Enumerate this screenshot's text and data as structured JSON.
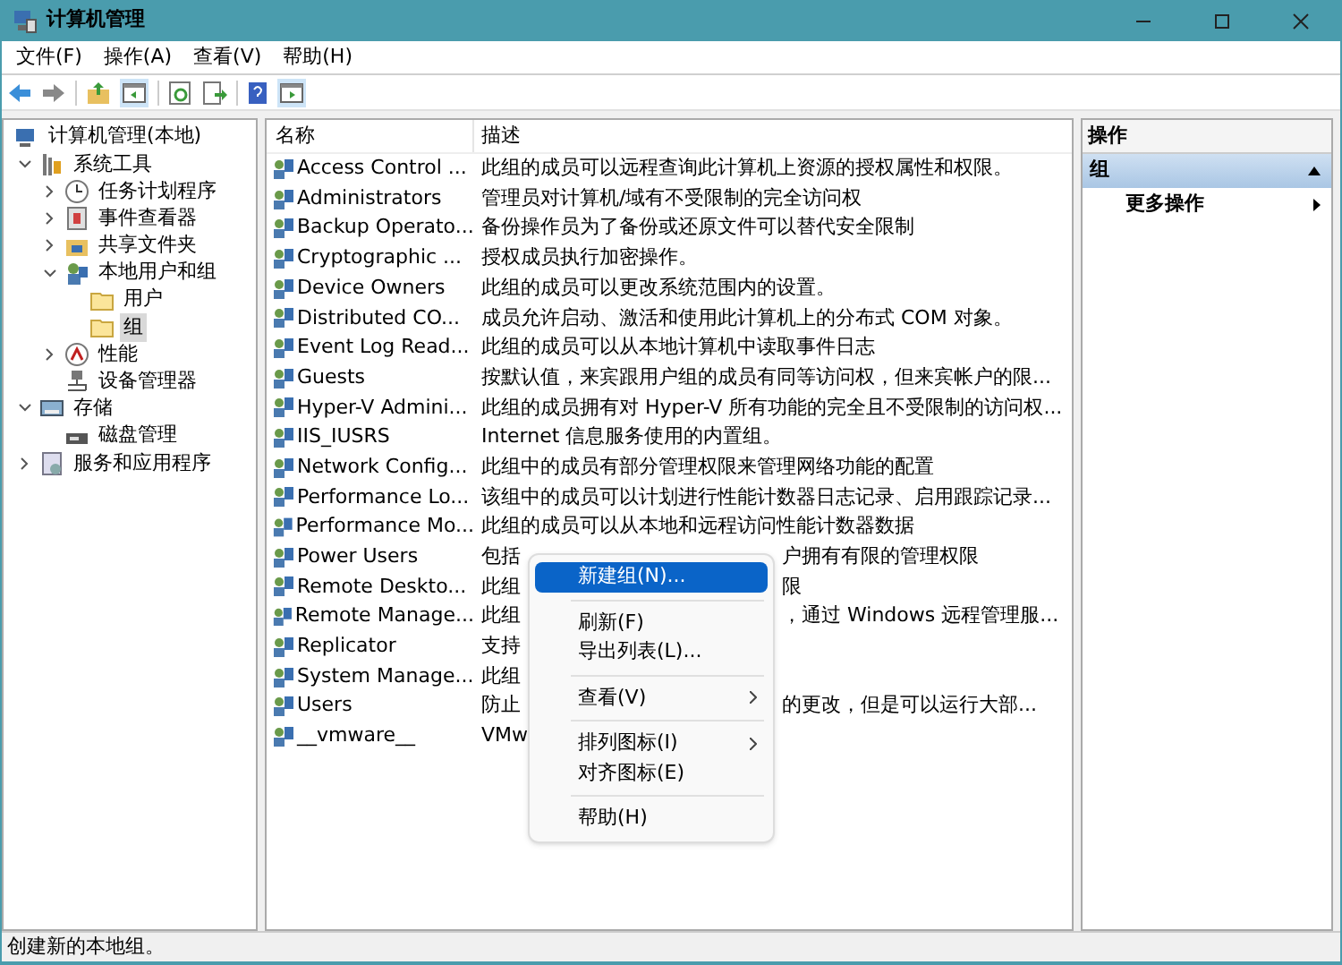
{
  "window": {
    "title": "计算机管理"
  },
  "menu_bar": [
    "文件(F)",
    "操作(A)",
    "查看(V)",
    "帮助(H)"
  ],
  "tree": [
    {
      "label": "计算机管理(本地)",
      "kind": "computer",
      "selected": false,
      "children": [
        {
          "label": "系统工具",
          "kind": "tools",
          "selected": false,
          "expanded": true,
          "children": [
            {
              "label": "任务计划程序",
              "kind": "clock",
              "selected": false,
              "expanded": false
            },
            {
              "label": "事件查看器",
              "kind": "log",
              "selected": false,
              "expanded": false
            },
            {
              "label": "共享文件夹",
              "kind": "share",
              "selected": false,
              "expanded": false
            },
            {
              "label": "本地用户和组",
              "kind": "users",
              "selected": false,
              "expanded": true,
              "children": [
                {
                  "label": "用户",
                  "kind": "folder",
                  "selected": false
                },
                {
                  "label": "组",
                  "kind": "folder",
                  "selected": true
                }
              ]
            },
            {
              "label": "性能",
              "kind": "perf",
              "selected": false,
              "expanded": false
            },
            {
              "label": "设备管理器",
              "kind": "device",
              "selected": false
            }
          ]
        },
        {
          "label": "存储",
          "kind": "storage",
          "selected": false,
          "expanded": true,
          "children": [
            {
              "label": "磁盘管理",
              "kind": "disk",
              "selected": false
            }
          ]
        },
        {
          "label": "服务和应用程序",
          "kind": "services",
          "selected": false,
          "expanded": false
        }
      ]
    }
  ],
  "table": {
    "columns": [
      "名称",
      "描述"
    ],
    "rows": [
      {
        "name": "Access Control ...",
        "description": "此组的成员可以远程查询此计算机上资源的授权属性和权限。"
      },
      {
        "name": "Administrators",
        "description": "管理员对计算机/域有不受限制的完全访问权"
      },
      {
        "name": "Backup Operato...",
        "description": "备份操作员为了备份或还原文件可以替代安全限制"
      },
      {
        "name": "Cryptographic ...",
        "description": "授权成员执行加密操作。"
      },
      {
        "name": "Device Owners",
        "description": "此组的成员可以更改系统范围内的设置。"
      },
      {
        "name": "Distributed CO...",
        "description": "成员允许启动、激活和使用此计算机上的分布式 COM 对象。"
      },
      {
        "name": "Event Log Read...",
        "description": "此组的成员可以从本地计算机中读取事件日志"
      },
      {
        "name": "Guests",
        "description": "按默认值，来宾跟用户组的成员有同等访问权，但来宾帐户的限..."
      },
      {
        "name": "Hyper-V Admini...",
        "description": "此组的成员拥有对 Hyper-V 所有功能的完全且不受限制的访问权..."
      },
      {
        "name": "IIS_IUSRS",
        "description": "Internet 信息服务使用的内置组。"
      },
      {
        "name": "Network Config...",
        "description": "此组中的成员有部分管理权限来管理网络功能的配置"
      },
      {
        "name": "Performance Lo...",
        "description": "该组中的成员可以计划进行性能计数器日志记录、启用跟踪记录..."
      },
      {
        "name": "Performance Mo...",
        "description": "此组的成员可以从本地和远程访问性能计数器数据"
      },
      {
        "name": "Power Users",
        "description": "包括",
        "description_tail": "户拥有有限的管理权限"
      },
      {
        "name": "Remote Deskto...",
        "description": "此组",
        "description_tail": "限"
      },
      {
        "name": "Remote Manage...",
        "description": "此组",
        "description_tail": "，通过 Windows 远程管理服..."
      },
      {
        "name": "Replicator",
        "description": "支持"
      },
      {
        "name": "System Manage...",
        "description": "此组"
      },
      {
        "name": "Users",
        "description": "防止",
        "description_tail": "的更改，但是可以运行大部..."
      },
      {
        "name": "__vmware__",
        "description": "VMw"
      }
    ]
  },
  "actions": {
    "header": "操作",
    "section": "组",
    "items": [
      {
        "label": "更多操作"
      }
    ]
  },
  "context_menu": [
    {
      "kind": "item",
      "label": "新建组(N)...",
      "selected": true,
      "submenu": false
    },
    {
      "kind": "separator"
    },
    {
      "kind": "item",
      "label": "刷新(F)",
      "selected": false,
      "submenu": false
    },
    {
      "kind": "item",
      "label": "导出列表(L)...",
      "selected": false,
      "submenu": false
    },
    {
      "kind": "separator"
    },
    {
      "kind": "item",
      "label": "查看(V)",
      "selected": false,
      "submenu": true
    },
    {
      "kind": "separator"
    },
    {
      "kind": "item",
      "label": "排列图标(I)",
      "selected": false,
      "submenu": true
    },
    {
      "kind": "item",
      "label": "对齐图标(E)",
      "selected": false,
      "submenu": false
    },
    {
      "kind": "separator"
    },
    {
      "kind": "item",
      "label": "帮助(H)",
      "selected": false,
      "submenu": false
    }
  ],
  "status_bar": "创建新的本地组。"
}
